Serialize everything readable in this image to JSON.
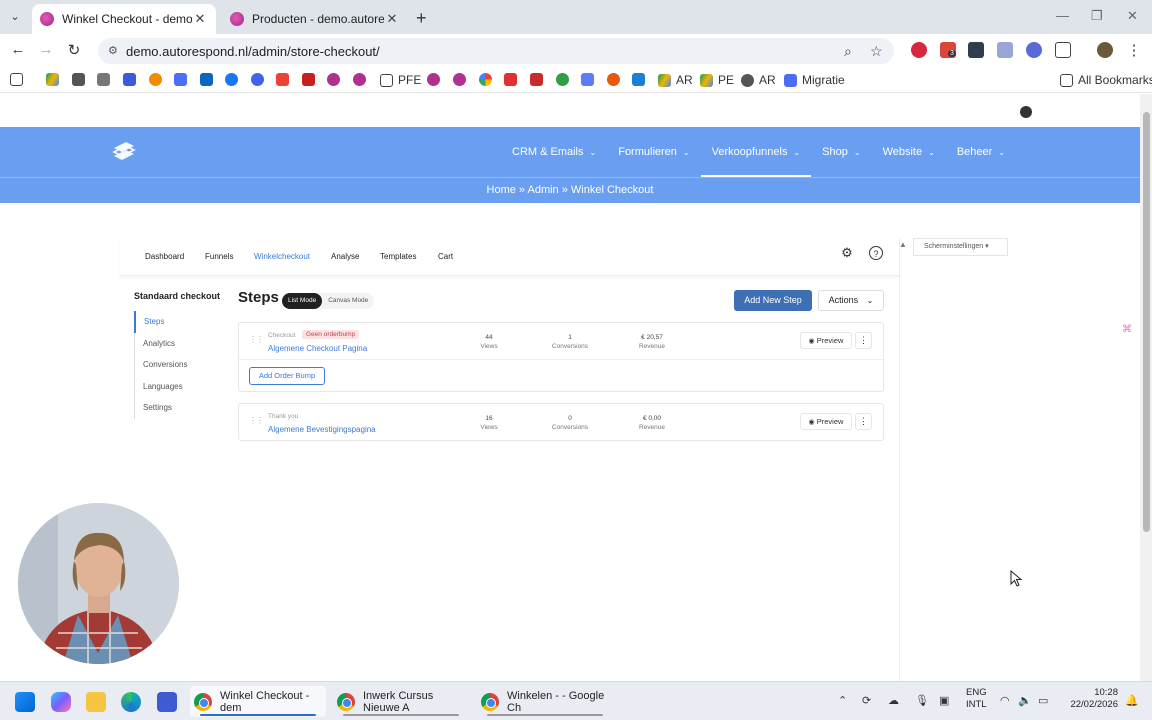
{
  "browser": {
    "tabs": [
      {
        "title": "Winkel Checkout - demo.autore",
        "active": true
      },
      {
        "title": "Producten - demo.autorespond",
        "active": false
      }
    ],
    "url": "demo.autorespond.nl/admin/store-checkout/",
    "extension_badge": "3",
    "bookmarks": [
      "PFE",
      "AR",
      "PE",
      "AR",
      "Migratie"
    ],
    "all_bookmarks": "All Bookmarks"
  },
  "header": {
    "nav": [
      {
        "label": "CRM & Emails",
        "active": false
      },
      {
        "label": "Formulieren",
        "active": false
      },
      {
        "label": "Verkoopfunnels",
        "active": true
      },
      {
        "label": "Shop",
        "active": false
      },
      {
        "label": "Website",
        "active": false
      },
      {
        "label": "Beheer",
        "active": false
      }
    ],
    "breadcrumb": "Home » Admin » Winkel Checkout"
  },
  "subnav": {
    "items": [
      "Dashboard",
      "Funnels",
      "Winkelcheckout",
      "Analyse",
      "Templates",
      "Cart"
    ],
    "active": "Winkelcheckout"
  },
  "screen_settings": "Scherminstellingen ▾",
  "sidebar": {
    "title": "Standaard checkout",
    "items": [
      "Steps",
      "Analytics",
      "Conversions",
      "Languages",
      "Settings"
    ],
    "active": "Steps"
  },
  "main": {
    "title": "Steps",
    "modes": [
      "List Mode",
      "Canvas Mode"
    ],
    "add_button": "Add New Step",
    "actions_button": "Actions",
    "steps": [
      {
        "type": "Checkout",
        "badge": "Geen orderbump",
        "name": "Algemene Checkout Pagina",
        "views": "44",
        "views_label": "Views",
        "conversions": "1",
        "conversions_label": "Conversions",
        "revenue": "€ 20,57",
        "revenue_label": "Revenue",
        "preview": "Preview",
        "bump_button": "Add Order Bump"
      },
      {
        "type": "Thank you",
        "name": "Algemene Bevestigingspagina",
        "views": "16",
        "views_label": "Views",
        "conversions": "0",
        "conversions_label": "Conversions",
        "revenue": "€ 0,00",
        "revenue_label": "Revenue",
        "preview": "Preview"
      }
    ]
  },
  "taskbar": {
    "apps": [
      {
        "label": "Winkel Checkout - dem",
        "active": true
      },
      {
        "label": "Inwerk Cursus Nieuwe A",
        "active": false
      },
      {
        "label": "Winkelen - - Google Ch",
        "active": false
      }
    ],
    "lang_top": "ENG",
    "lang_bottom": "INTL",
    "time": "10:28",
    "date": "22/02/2026"
  },
  "colors": {
    "header_blue": "#6a9ef0",
    "primary_button": "#3d6fb4",
    "link_blue": "#3b7ad9",
    "badge_red": "#c04545"
  }
}
